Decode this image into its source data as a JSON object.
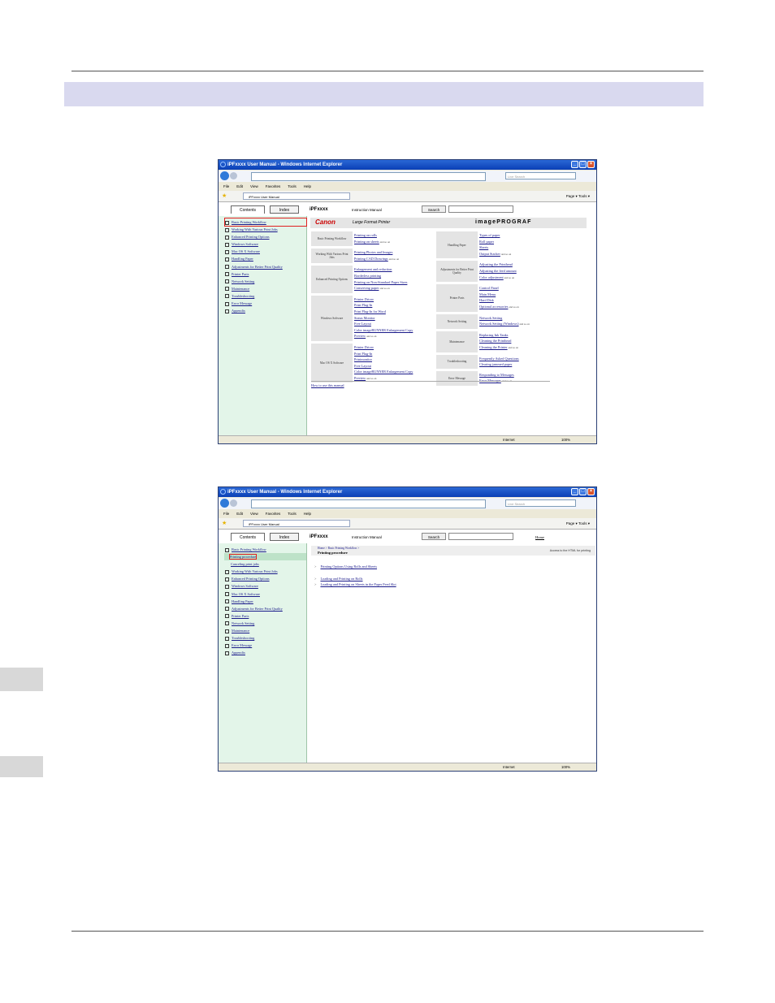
{
  "browser": {
    "window_title": "iPFxxxx User Manual - Windows Internet Explorer",
    "search_placeholder": "Live Search",
    "menu": [
      "File",
      "Edit",
      "View",
      "Favorites",
      "Tools",
      "Help"
    ],
    "tab_title": "iPFxxxx User Manual",
    "toolbar_text": "Page ▾  Tools ▾",
    "status_zone": "Internet",
    "zoom": "100%"
  },
  "manual": {
    "contents_tab": "Contents",
    "index_tab": "Index",
    "product": "iPFxxxx",
    "manual_name": "Instruction Manual",
    "search_button": "Search",
    "home_link": "Home",
    "brand": "Canon",
    "brand_sub": "Large Format Printer",
    "product_line": "imagePROGRAF",
    "toc": [
      "Basic Printing Workflow",
      "Working With Various Print Jobs",
      "Enhanced Printing Options",
      "Windows Software",
      "Mac OS X Software",
      "Handling Paper",
      "Adjustments for Better Print Quality",
      "Printer Parts",
      "Network Setting",
      "Maintenance",
      "Troubleshooting",
      "Error Message",
      "Appendix"
    ],
    "toc_sub": [
      "Printing procedure",
      "Canceling print jobs"
    ],
    "and_so_on": "and so on",
    "groups_left": [
      {
        "name": "Basic Printing Workflow",
        "links": [
          "Printing on rolls",
          "Printing on sheets"
        ]
      },
      {
        "name": "Working With Various Print Jobs",
        "links": [
          "Printing Photos and Images",
          "Printing CAD Drawings"
        ]
      },
      {
        "name": "Enhanced Printing Options",
        "links": [
          "Enlargement and reduction",
          "Borderless printing",
          "Printing on Non-Standard Paper Sizes",
          "Conserving paper"
        ]
      },
      {
        "name": "Windows Software",
        "links": [
          "Printer Driver",
          "Print Plug-In",
          "Print Plug-In for Word",
          "Status Monitor",
          "Free Layout",
          "Color imageRUNNER Enlargement Copy",
          "Preview"
        ]
      },
      {
        "name": "Mac OS X Software",
        "links": [
          "Printer Driver",
          "Print Plug-In",
          "Printmonitor",
          "Free Layout",
          "Color imageRUNNER Enlargement Copy",
          "Preview"
        ]
      }
    ],
    "groups_right": [
      {
        "name": "Handling Paper",
        "links": [
          "Types of paper",
          "Roll paper",
          "Sheets",
          "Output Stacker"
        ]
      },
      {
        "name": "Adjustments for Better Print Quality",
        "links": [
          "Adjusting the Printhead",
          "Adjusting the feed amount",
          "Color adjustment"
        ]
      },
      {
        "name": "Printer Parts",
        "links": [
          "Control Panel",
          "Main Menu",
          "Hard Disk",
          "Optional accessories"
        ]
      },
      {
        "name": "Network Setting",
        "links": [
          "Network Setting",
          "Network Setting (Windows)"
        ]
      },
      {
        "name": "Maintenance",
        "links": [
          "Replacing Ink Tanks",
          "Cleaning the Printhead",
          "Cleaning the Printer"
        ]
      },
      {
        "name": "Troubleshooting",
        "links": [
          "Frequently Asked Questions",
          "Clearing jammed paper"
        ]
      },
      {
        "name": "Error Message",
        "links": [
          "Responding to Messages",
          "Error Messages"
        ]
      }
    ],
    "how_to": "How to use this manual",
    "breadcrumb": "Home > Basic Printing Workflow >",
    "page_title": "Printing procedure",
    "html_link": "Access to the HTML for printing",
    "page_links": [
      "Printing Options Using Rolls and Sheets",
      "Loading and Printing on Rolls",
      "Loading and Printing on Sheets in the Paper Feed Slot"
    ]
  }
}
